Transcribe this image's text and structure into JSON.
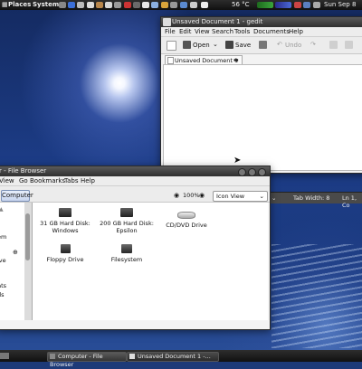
{
  "top_panel": {
    "menus": [
      "Places",
      "System"
    ],
    "temperature": "56 °C",
    "clock": "Sun Sep 8"
  },
  "gedit": {
    "title": "Unsaved Document 1 - gedit",
    "menus": [
      "File",
      "Edit",
      "View",
      "Search",
      "Tools",
      "Documents",
      "Help"
    ],
    "toolbar": {
      "open_label": "Open",
      "save_label": "Save",
      "undo_label": "Undo"
    },
    "tab_label": "Unsaved Document 1",
    "status": {
      "tab_width": "Tab Width: 8",
      "position": "Ln 1, Co"
    }
  },
  "file_browser": {
    "title": "r - File Browser",
    "menus": [
      "View",
      "Go",
      "Bookmarks",
      "Tabs",
      "Help"
    ],
    "location_button": "Computer",
    "zoom": "100%",
    "view_mode": "Icon View",
    "sidebar_fragments": [
      "em",
      "ive",
      "nts",
      "ds"
    ],
    "devices": [
      {
        "label": "31 GB Hard Disk:\nWindows",
        "kind": "hdd"
      },
      {
        "label": "200 GB Hard Disk:\nEpsilon",
        "kind": "hdd"
      },
      {
        "label": "CD/DVD Drive",
        "kind": "cd"
      },
      {
        "label": "Floppy Drive",
        "kind": "floppy"
      },
      {
        "label": "Filesystem",
        "kind": "fs"
      }
    ]
  },
  "bottom_panel": {
    "tasks": [
      "Computer - File Browser",
      "Unsaved Document 1 -..."
    ]
  },
  "colors": {
    "wallpaper": "#1d3a78",
    "panel": "#1a1a1a",
    "location_active": "#c9d6ef"
  }
}
